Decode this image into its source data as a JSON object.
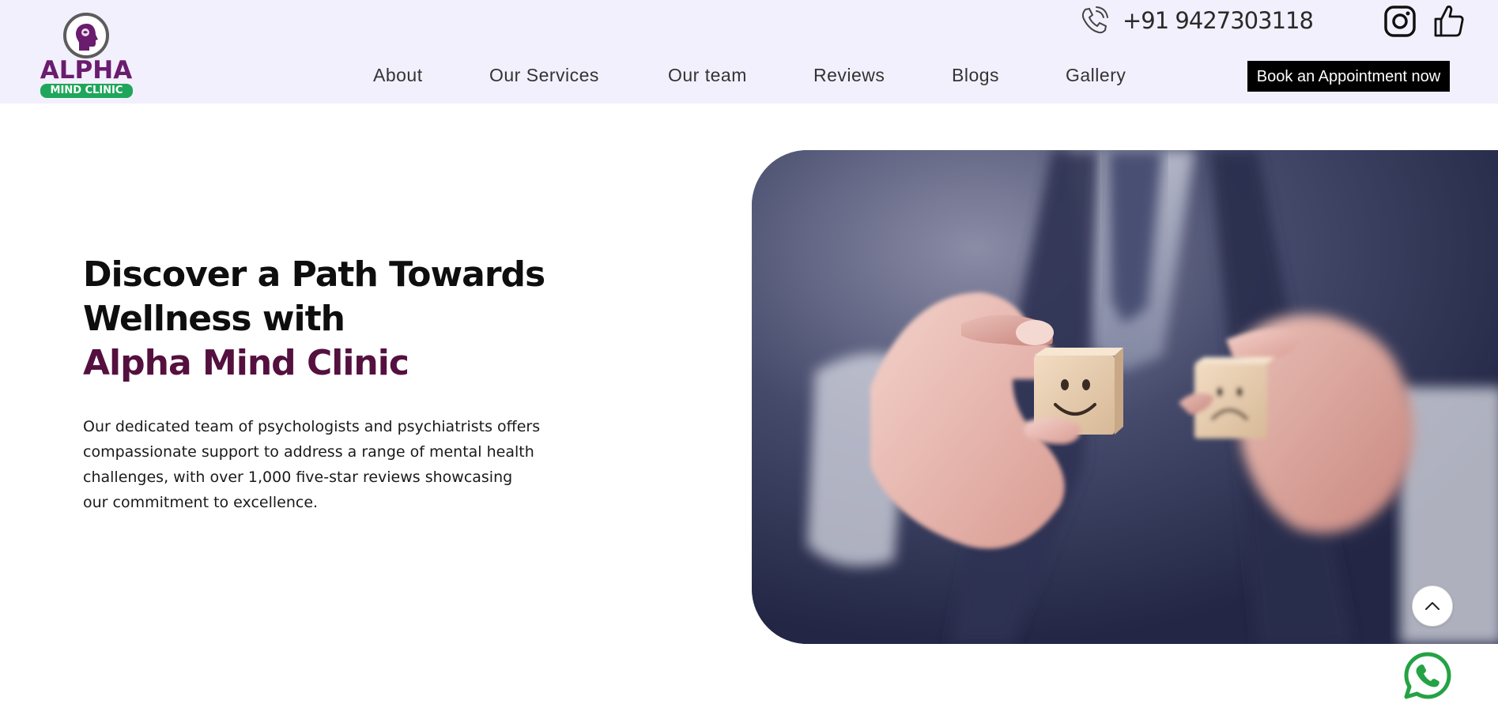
{
  "brand": {
    "logo_word": "ALPHA",
    "logo_sub": "MIND CLINIC"
  },
  "header": {
    "phone": "+91 9427303118",
    "nav": [
      "About",
      "Our Services",
      "Our team",
      "Reviews",
      "Blogs",
      "Gallery"
    ],
    "cta_label": "Book an Appointment now"
  },
  "hero": {
    "title_line1": "Discover a Path Towards",
    "title_line2": "Wellness with",
    "title_line3": "Alpha Mind Clinic",
    "description": "Our dedicated team of psychologists and psychiatrists offers compassionate support to address a range of mental health challenges, with over 1,000 five-star reviews showcasing our commitment to excellence."
  },
  "icons": {
    "phone": "phone-icon",
    "instagram": "instagram-icon",
    "like": "thumbs-up-icon",
    "scroll_top": "chevron-up-icon",
    "whatsapp": "whatsapp-icon"
  },
  "colors": {
    "header_bg": "#f3f0fd",
    "accent": "#54103f",
    "logo_purple": "#6a1c6e",
    "logo_green": "#1fa65a",
    "cta_bg": "#000000",
    "whatsapp_green": "#25a244"
  }
}
